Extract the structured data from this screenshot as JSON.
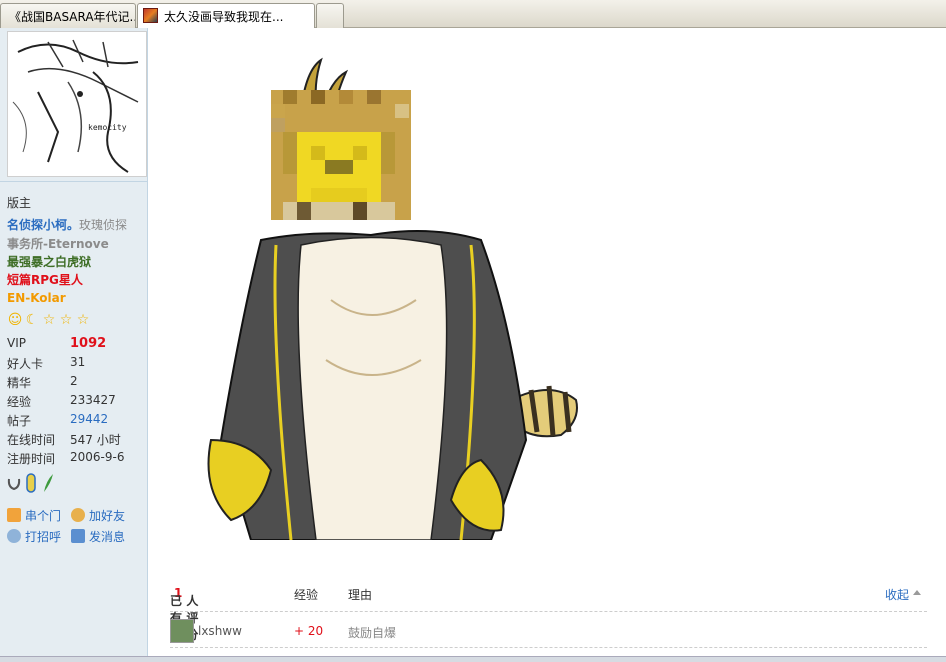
{
  "tabs": [
    {
      "label": "《战国BASARA年代记..."
    },
    {
      "label": "太久没画导致我现在..."
    },
    {
      "label": ""
    }
  ],
  "avatar": {
    "caption": "kemocity"
  },
  "profile": {
    "role": "版主",
    "signature": {
      "line1_name": "名侦探小柯。",
      "line1_rest": "玫瑰侦探",
      "line2": "事务所-Eternove",
      "line3": "最强暴之白虎狱",
      "line4": "短篇RPG星人",
      "line5": "EN-Kolar"
    },
    "stats": [
      {
        "label": "VIP",
        "value": "1092"
      },
      {
        "label": "好人卡",
        "value": "31"
      },
      {
        "label": "精华",
        "value": "2"
      },
      {
        "label": "经验",
        "value": "233427"
      },
      {
        "label": "帖子",
        "value": "29442"
      },
      {
        "label": "在线时间",
        "value": "547 小时"
      },
      {
        "label": "注册时间",
        "value": "2006-9-6"
      }
    ],
    "actions": {
      "visit": "串个门",
      "add_friend": "加好友",
      "greet": "打招呼",
      "message": "发消息"
    }
  },
  "rating": {
    "header": {
      "prefix": "已有",
      "count": "1",
      "suffix": "人评分",
      "col_exp": "经验",
      "col_reason": "理由",
      "collapse": "收起"
    },
    "rows": [
      {
        "user": "lxshww",
        "exp": "+ 20",
        "reason": "鼓励自爆"
      }
    ]
  },
  "colors": {
    "accent": "#2a6cc0",
    "sidebar_bg": "#e5edf2",
    "highlight_red": "#e0101a"
  }
}
